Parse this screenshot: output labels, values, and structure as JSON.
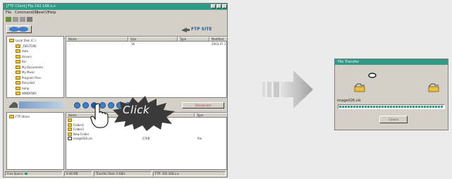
{
  "main_window": {
    "title": "[FTP Client] Ftp 192.168.x.x",
    "menu": [
      "File",
      "Command(C)",
      "View(V)",
      "Help"
    ],
    "location_text": "FTP SITE",
    "upper_tree": [
      "Local Disk (C:)",
      "_RESTORE",
      "data",
      "drivers",
      "Ksr",
      "My Documents",
      "My Music",
      "Program Files",
      "Recycled",
      "temp",
      "WINDOWS"
    ],
    "upper_columns": [
      "Name",
      "Size",
      "Type",
      "Modified"
    ],
    "upper_rows": [
      {
        "name": "..",
        "size": "1K",
        "type": "",
        "modified": "2003.07.1"
      }
    ],
    "lower_tree": [
      "FTP Share"
    ],
    "lower_columns": [
      "Name",
      "Size",
      "Type"
    ],
    "lower_rows": [
      {
        "name": "..",
        "size": "",
        "type": ""
      },
      {
        "name": "Folder1",
        "size": "",
        "type": ""
      },
      {
        "name": "Folder2",
        "size": "",
        "type": ""
      },
      {
        "name": "New Folder",
        "size": "",
        "type": ""
      },
      {
        "name": "image026.xls",
        "size": "27KB",
        "type": "file"
      }
    ],
    "disconnect_label": "Disconnect",
    "status": [
      "Free Space: ",
      "9.48 MB",
      "Transfer Rate: 0 KB/s",
      "FTP: 192.168.x.x"
    ]
  },
  "click_callout": {
    "label": "Click"
  },
  "dialog": {
    "title": "File Transfer",
    "filename": "image026.xls",
    "progress_fraction": 1.0,
    "cancel_label": "Cancel"
  },
  "colors": {
    "titlebar": "#2f9a86",
    "progress_block": "#2f9a86",
    "arrow_tip": "#a0a0a0",
    "burst": "#3a3a3a",
    "action_button": "#3f7fc9",
    "folder": "#e8c140"
  }
}
